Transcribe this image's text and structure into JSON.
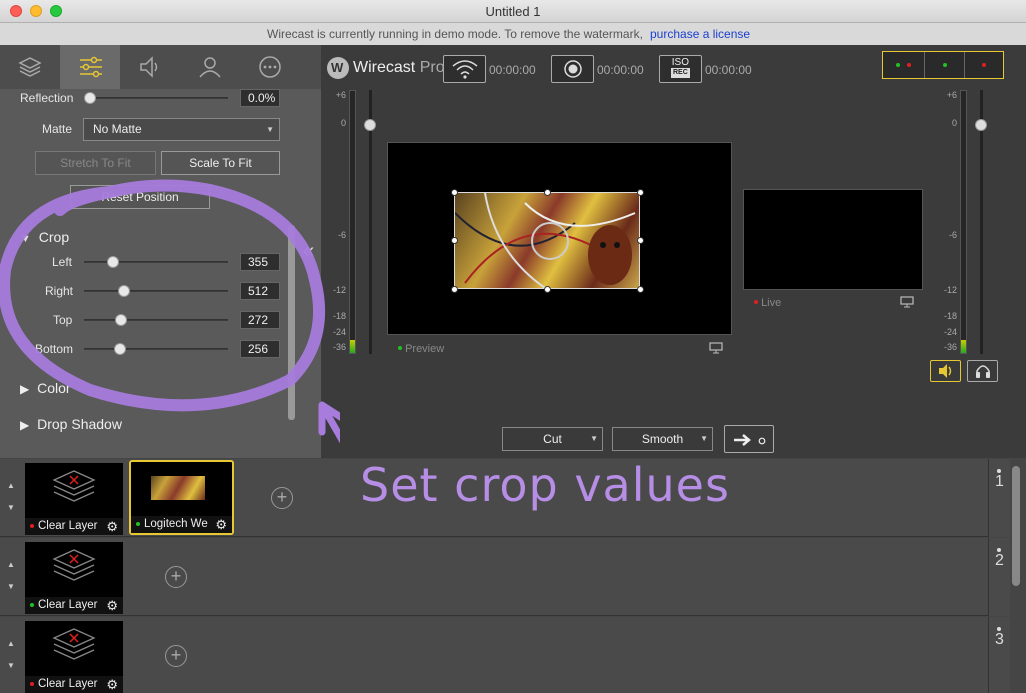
{
  "window": {
    "title": "Untitled 1"
  },
  "demo_bar": {
    "message": "Wirecast is currently running in demo mode. To remove the watermark,",
    "link": "purchase a license"
  },
  "tabs": [
    "layers-icon",
    "settings-sliders-icon",
    "audio-icon",
    "person-icon",
    "more-icon"
  ],
  "properties": {
    "reflection_label": "Reflection",
    "reflection_value": "0.0%",
    "matte_label": "Matte",
    "matte_value": "No Matte",
    "stretch_btn": "Stretch To Fit",
    "scale_btn": "Scale To Fit",
    "reset_btn": "Reset Position",
    "crop_section": "Crop",
    "crop": [
      {
        "label": "Left",
        "value": "355",
        "fraction": 0.2
      },
      {
        "label": "Right",
        "value": "512",
        "fraction": 0.28
      },
      {
        "label": "Top",
        "value": "272",
        "fraction": 0.26
      },
      {
        "label": "Bottom",
        "value": "256",
        "fraction": 0.25
      }
    ],
    "color_section": "Color",
    "shadow_section": "Drop Shadow"
  },
  "toolbar": {
    "logo": "Wirecast",
    "logo_suffix": "Pro",
    "stream_time": "00:00:00",
    "record_time": "00:00:00",
    "iso_time": "00:00:00",
    "iso_label_top": "ISO",
    "iso_label_bottom": "REC"
  },
  "meter_ticks": [
    "+6",
    "0",
    "-6",
    "-12",
    "-18",
    "-24",
    "-36"
  ],
  "preview": {
    "label": "Preview",
    "live_label": "Live"
  },
  "transition": {
    "cut": "Cut",
    "smooth": "Smooth"
  },
  "layers": [
    {
      "number": "1",
      "shots": [
        {
          "label": "Clear Layer",
          "status": "red"
        },
        {
          "label": "Logitech Webcam",
          "status": "green",
          "selected": true
        }
      ]
    },
    {
      "number": "2",
      "shots": [
        {
          "label": "Clear Layer",
          "status": "green"
        }
      ]
    },
    {
      "number": "3",
      "shots": [
        {
          "label": "Clear Layer",
          "status": "red"
        }
      ]
    }
  ],
  "annotation": {
    "text": "Set crop values"
  },
  "colors": {
    "accent_yellow": "#e8c832",
    "annotation_purple": "#a77cdd",
    "live_red": "#e02020",
    "ok_green": "#22c022"
  }
}
